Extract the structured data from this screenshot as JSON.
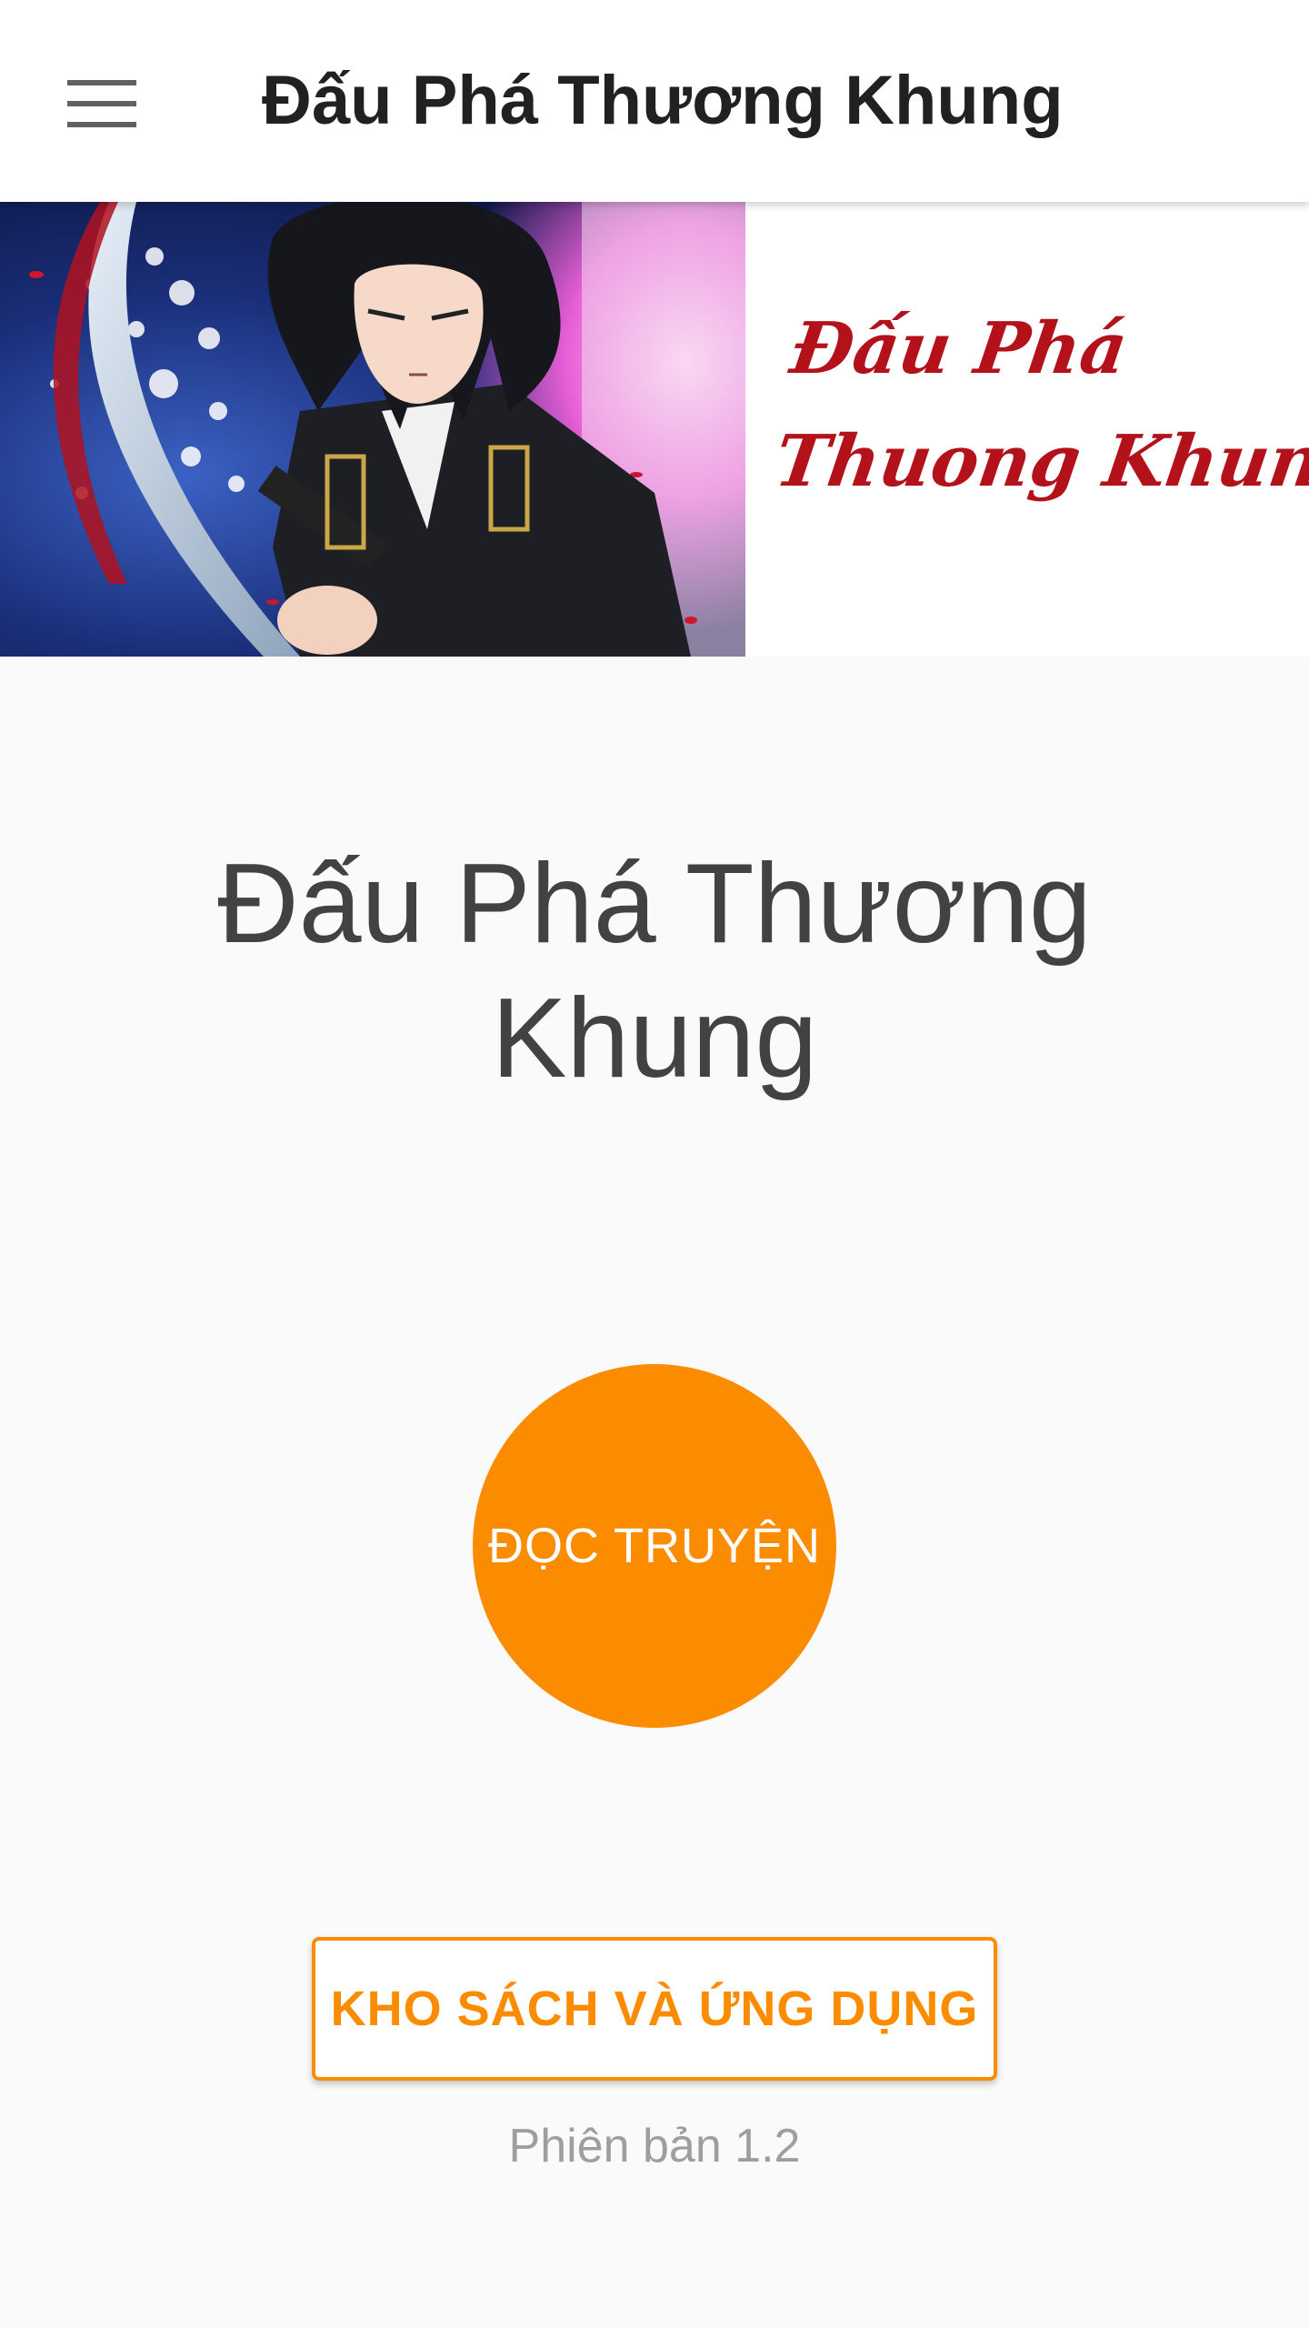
{
  "appbar": {
    "menu_icon": "menu-icon",
    "title": "Đấu Phá Thương Khung"
  },
  "banner": {
    "caption_line1": "Đấu Phá",
    "caption_line2": "Thuong Khung",
    "caption_color": "#b3121b",
    "artwork": "manga character with sword illustration"
  },
  "main": {
    "title": "Đấu Phá Thương Khung",
    "read_button_label": "ĐỌC TRUYỆN",
    "store_button_label": "KHO SÁCH VÀ ỨNG DỤNG",
    "version_text": "Phiên bản 1.2"
  },
  "colors": {
    "accent": "#fb8c00",
    "title_text": "#424242",
    "version_text": "#9e9e9e"
  }
}
